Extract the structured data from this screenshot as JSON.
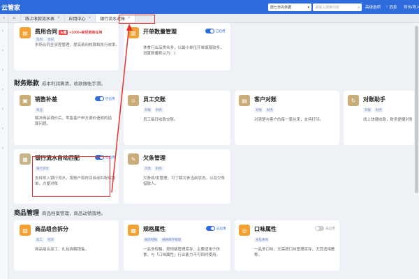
{
  "topbar": {
    "brand": "云管家",
    "store_select": "唐七日内单据",
    "search_placeholder": "请输入搜索内容",
    "links": {
      "help": "高级选项",
      "messages": "消息",
      "import": "导出/导入"
    }
  },
  "tabs": [
    {
      "label": "线上收款流水表"
    },
    {
      "label": "应用中心"
    },
    {
      "label": "银行流水对账"
    }
  ],
  "sections": {
    "finance": {
      "title": "财务账款",
      "desc": "成本利润算清，收款做账手滑。"
    },
    "goods": {
      "title": "商品管理",
      "desc": "商品档案管理，商品动销落地。"
    }
  },
  "cards": {
    "fee_contract": {
      "title": "费用合同",
      "badge": "火爆",
      "badge_text": "+1000+家经销商在用",
      "tags": [
        "签约",
        "合同"
      ],
      "desc": "市场合同全流程管理，提高费用核算和执行效率。"
    },
    "open_qty": {
      "title": "开单数量管理",
      "toggle": "已启用",
      "desc": "休食行业品类众多，以最小单位开单填报较多，设置数量默认为：1"
    },
    "sales_patch": {
      "title": "销售补差",
      "toggle": "已启用",
      "tags": [
        "商品"
      ],
      "desc": "解决商品调价后，零售客户申方调价造成的结算问题。"
    },
    "staff_ledger": {
      "title": "员工交账",
      "tags": [
        "对账",
        "财务"
      ],
      "desc": "员工每日收款交账。"
    },
    "customer_recon": {
      "title": "客户对账",
      "tags": [
        "对账",
        "财务"
      ],
      "desc": "对清楚与客户的每一笔往来，支持打印。"
    },
    "recon_helper": {
      "title": "对账助手",
      "tags": [
        "对账",
        "财务"
      ],
      "desc": "线上快捷收款，财务便捷对账"
    },
    "bank_match": {
      "title": "银行流水自动匹配",
      "toggle": "已启用",
      "tags": [
        "银行流水"
      ],
      "desc": "支持导入银行流水，按账户和时间自动匹配收款单，方便对账"
    },
    "debt": {
      "title": "欠条管理",
      "tags": [
        "欠款",
        "财务"
      ],
      "desc": "欠条收/发管理，可了解欠条当前状态，以及欠条借款人。"
    },
    "combo_split": {
      "title": "商品组合拆分",
      "tags": [
        "加工",
        "包装"
      ],
      "desc": "商品组合加工、礼包拆解销售。"
    },
    "spec_attr": {
      "title": "规格属性",
      "toggle": "已启用",
      "tags": [
        "服装鞋服",
        "规格库存管理"
      ],
      "desc": "一品多规格，按规格管理库存，主要适用于休食，与「口味属性」行业能力不可同时使用。"
    },
    "flavor_attr": {
      "title": "口味属性",
      "toggle": "未启用",
      "tags": [
        "食品休闲"
      ],
      "desc": "一品多口味，无需按口味管理库存，尤其适用散称。"
    }
  }
}
